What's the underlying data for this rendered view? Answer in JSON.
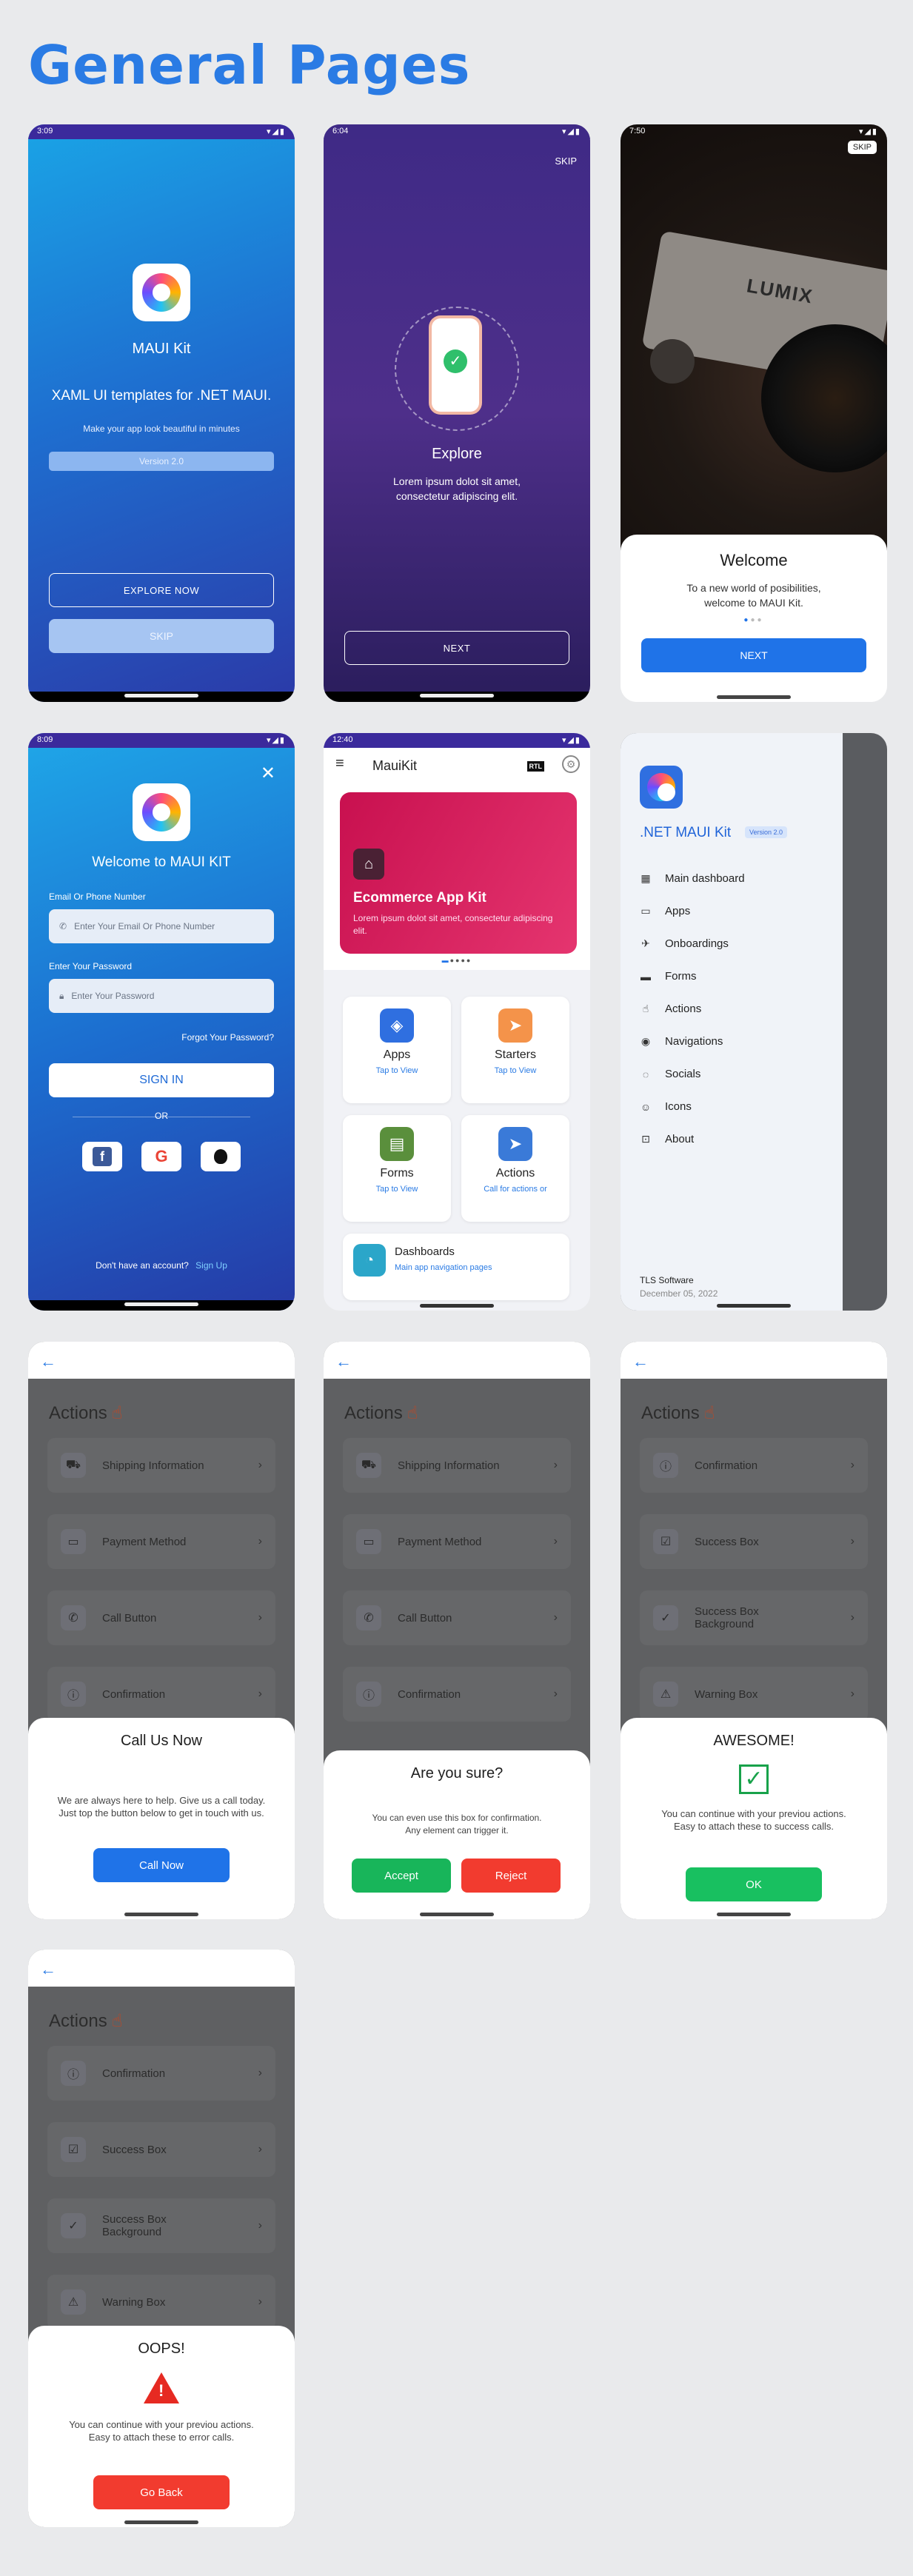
{
  "title": "General Pages",
  "splash": {
    "time": "3:09",
    "app_name": "MAUI Kit",
    "headline": "XAML UI templates for .NET MAUI.",
    "tagline": "Make your app look beautiful in minutes",
    "version": "Version 2.0",
    "explore": "EXPLORE NOW",
    "skip": "SKIP"
  },
  "onboarding": {
    "time": "6:04",
    "skip": "SKIP",
    "title": "Explore",
    "body": "Lorem ipsum dolot sit amet,\nconsectetur adipiscing elit.",
    "next": "NEXT"
  },
  "welcome": {
    "time": "7:50",
    "skip": "SKIP",
    "brand": "LUMIX",
    "title": "Welcome",
    "body": "To a new world of posibilities,\nwelcome to MAUI Kit.",
    "next": "NEXT"
  },
  "login": {
    "time": "8:09",
    "title": "Welcome to MAUI KIT",
    "email_label": "Email Or Phone Number",
    "email_placeholder": "Enter Your Email Or Phone Number",
    "password_label": "Enter Your Password",
    "password_placeholder": "Enter Your Password",
    "forgot": "Forgot Your Password?",
    "signin": "SIGN IN",
    "or": "OR",
    "no_account": "Don't have an account?",
    "signup": "Sign Up"
  },
  "home": {
    "time": "12:40",
    "app_title": "MauiKit",
    "rtl": "RTL",
    "banner_title": "Ecommerce App Kit",
    "banner_body": "Lorem ipsum dolot sit amet, consectetur adipiscing elit.",
    "cards": [
      {
        "name": "Apps",
        "sub": "Tap to View",
        "icon": "apps-icon",
        "color": "#2f6fe0"
      },
      {
        "name": "Starters",
        "sub": "Tap to View",
        "icon": "starters-icon",
        "color": "#f4934a"
      },
      {
        "name": "Forms",
        "sub": "Tap to View",
        "icon": "forms-icon",
        "color": "#5a8f3c"
      },
      {
        "name": "Actions",
        "sub": "Call for actions or",
        "icon": "actions-icon",
        "color": "#3a7ad8"
      }
    ],
    "dash_title": "Dashboards",
    "dash_sub": "Main app navigation pages"
  },
  "drawer": {
    "app_title": ".NET MAUI Kit",
    "version": "Version 2.0",
    "items": [
      {
        "label": "Main dashboard",
        "icon": "dashboard-icon",
        "glyph": "▦"
      },
      {
        "label": "Apps",
        "icon": "apps-icon",
        "glyph": "▭"
      },
      {
        "label": "Onboardings",
        "icon": "plane-icon",
        "glyph": "✈"
      },
      {
        "label": "Forms",
        "icon": "briefcase-icon",
        "glyph": "▬"
      },
      {
        "label": "Actions",
        "icon": "hand-icon",
        "glyph": "☝"
      },
      {
        "label": "Navigations",
        "icon": "compass-icon",
        "glyph": "◉"
      },
      {
        "label": "Socials",
        "icon": "chat-icon",
        "glyph": "◌"
      },
      {
        "label": "Icons",
        "icon": "smile-icon",
        "glyph": "☺"
      },
      {
        "label": "About",
        "icon": "info-icon",
        "glyph": "⊡"
      }
    ],
    "company": "TLS Software",
    "date": "December 05, 2022"
  },
  "actions_heading": "Actions",
  "rows_a": [
    {
      "label": "Shipping Information",
      "icon": "truck-icon",
      "glyph": "⛟"
    },
    {
      "label": "Payment Method",
      "icon": "card-icon",
      "glyph": "▭"
    },
    {
      "label": "Call Button",
      "icon": "phone-icon",
      "glyph": "✆"
    },
    {
      "label": "Confirmation",
      "icon": "info-icon",
      "glyph": "ⓘ"
    }
  ],
  "rows_b": [
    {
      "label": "Confirmation",
      "icon": "info-icon",
      "glyph": "ⓘ"
    },
    {
      "label": "Success Box",
      "icon": "check-box-icon",
      "glyph": "☑"
    },
    {
      "label": "Success Box\nBackground",
      "icon": "check-circle-icon",
      "glyph": "✓"
    },
    {
      "label": "Warning Box",
      "icon": "warning-icon",
      "glyph": "⚠"
    }
  ],
  "modal_call": {
    "title": "Call Us Now",
    "body": "We are always here to help. Give us a call today. Just top the button below to get in touch with us.",
    "button": "Call Now"
  },
  "modal_confirm": {
    "title": "Are you sure?",
    "body": "You can even use this box for confirmation.\nAny element can trigger it.",
    "accept": "Accept",
    "reject": "Reject"
  },
  "modal_success": {
    "title": "AWESOME!",
    "body": "You can continue with your previou actions.\nEasy to attach these to success calls.",
    "button": "OK"
  },
  "modal_error": {
    "title": "OOPS!",
    "body": "You can continue with your previou actions.\nEasy to attach these to error calls.",
    "button": "Go Back"
  }
}
